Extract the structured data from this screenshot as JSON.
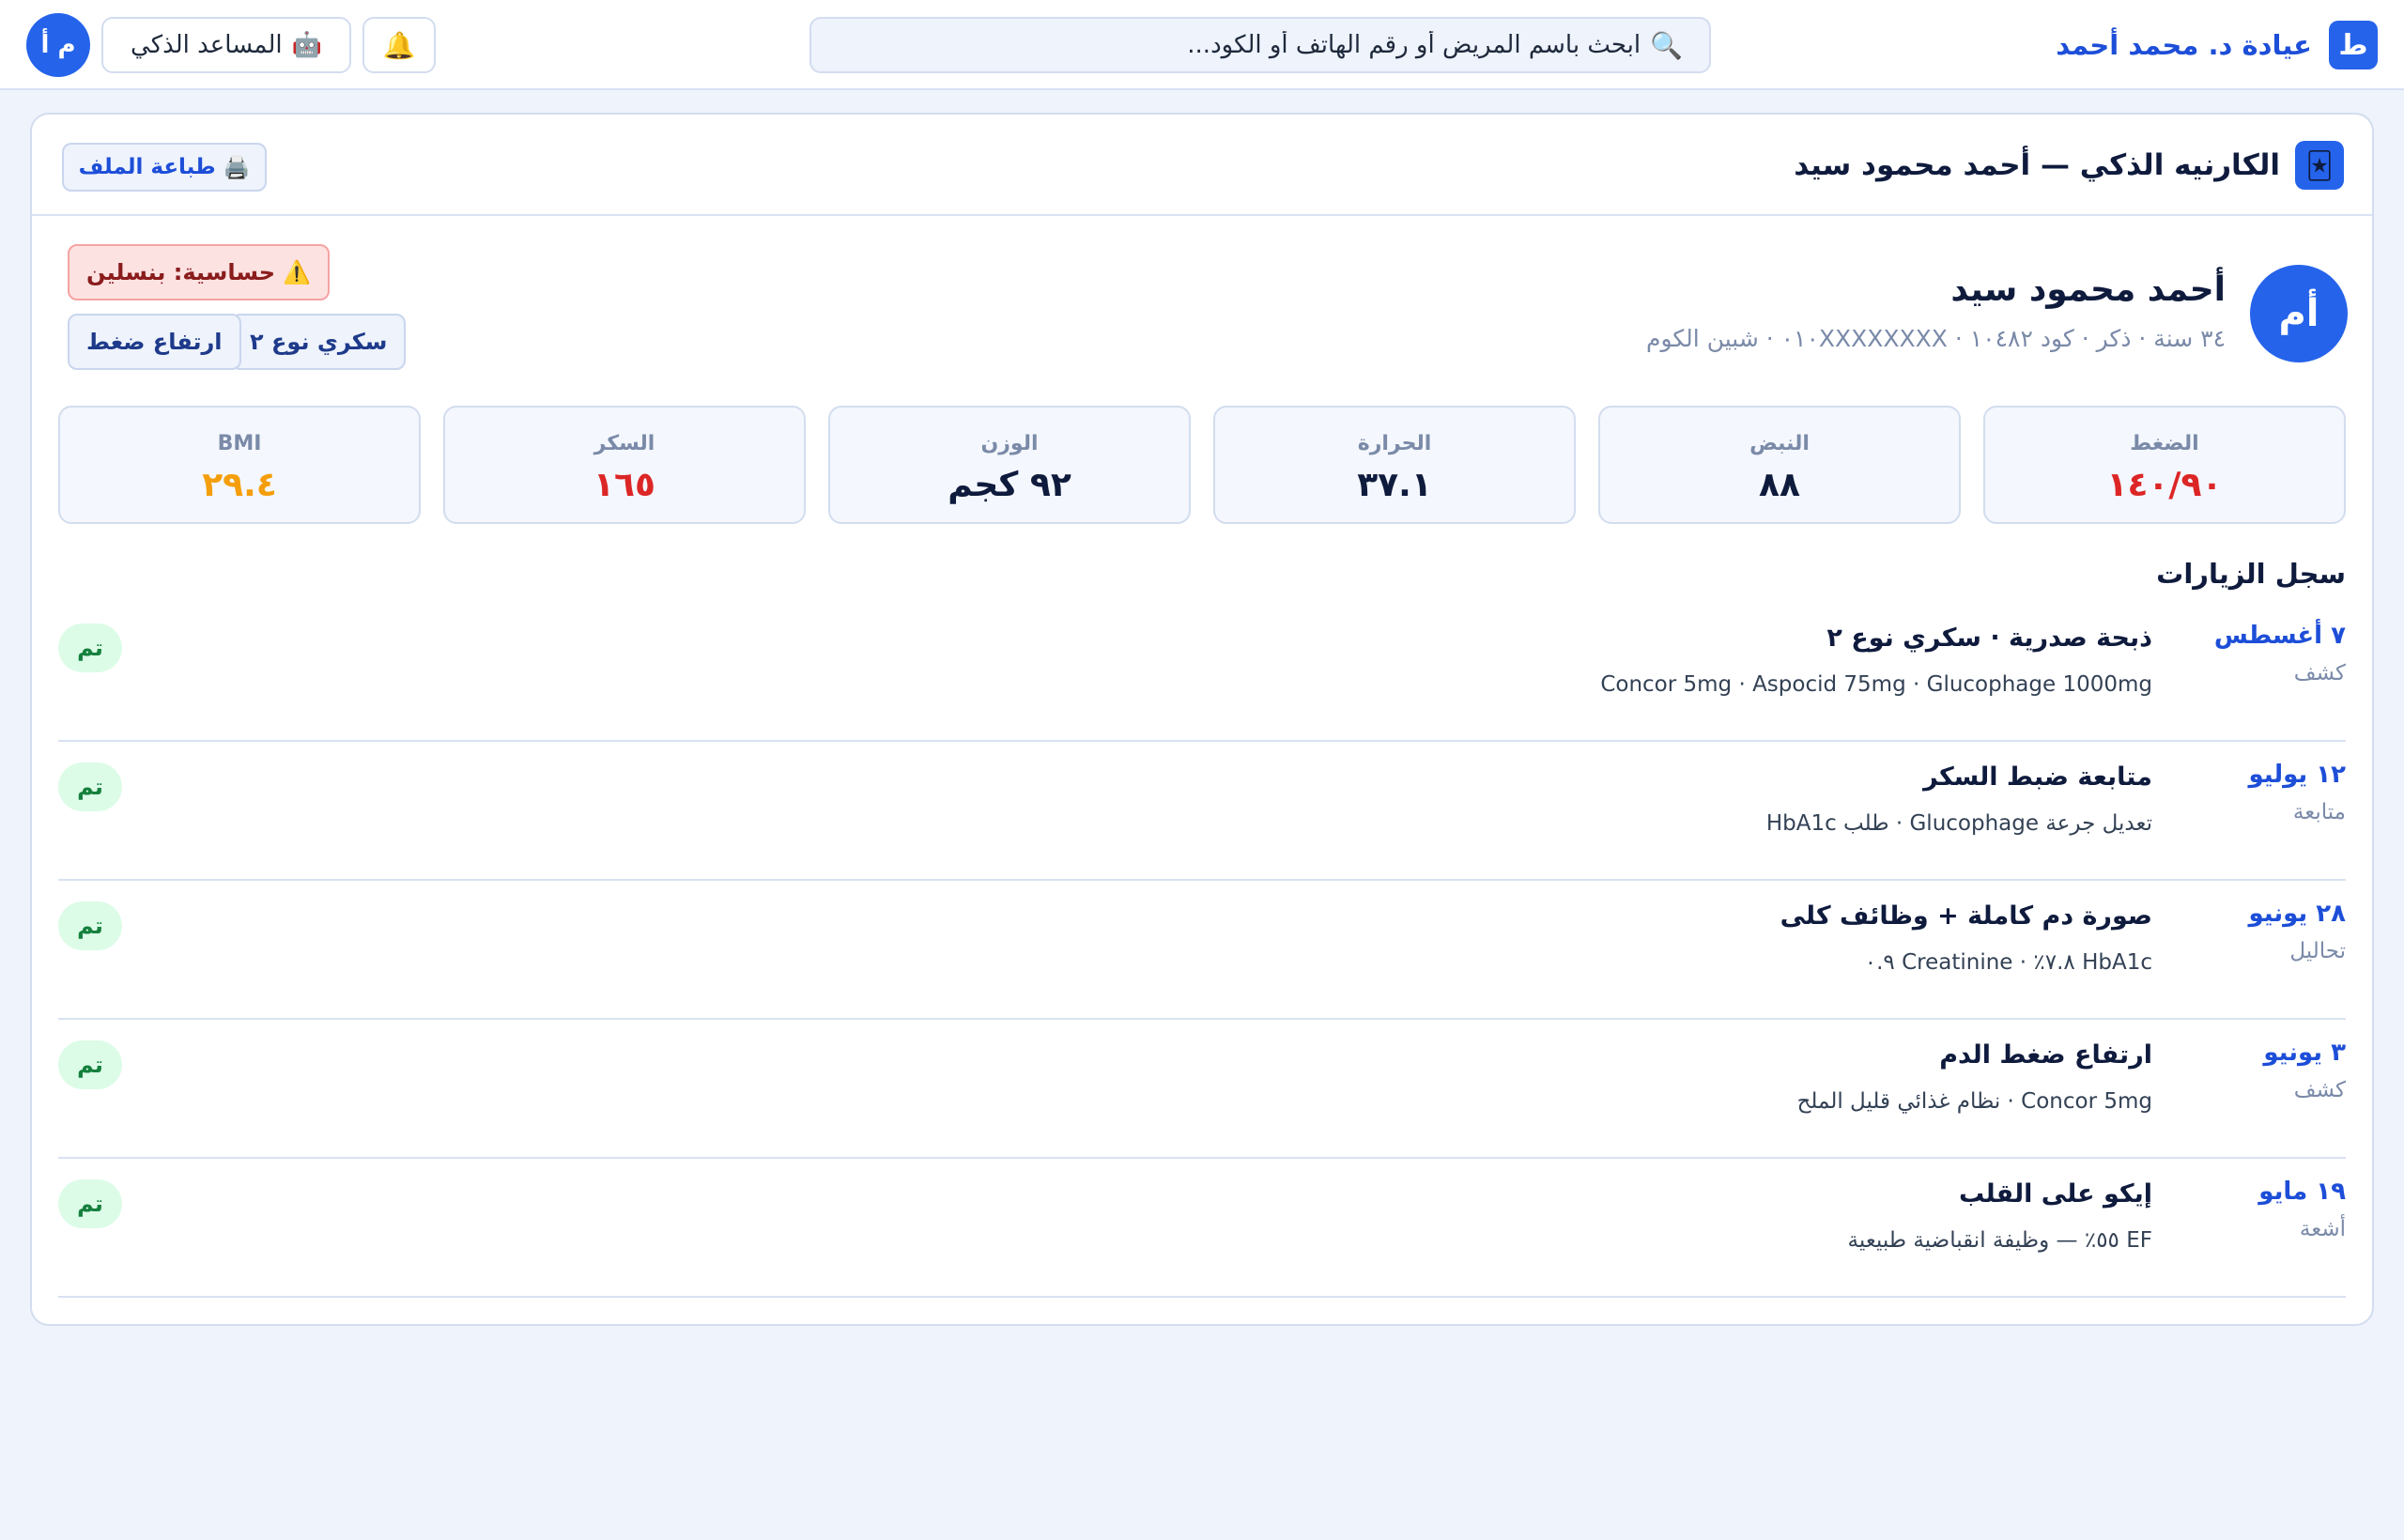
{
  "header": {
    "brand_initial": "ط",
    "brand_name": "عيادة د. محمد أحمد",
    "search_placeholder": "ابحث باسم المريض أو رقم الهاتف أو الكود...",
    "assistant_label": "المساعد الذكي",
    "user_initials": "م أ",
    "icons": {
      "search": "magnifier-icon",
      "bell": "bell-icon",
      "assistant": "robot-icon"
    }
  },
  "card": {
    "title": "الكارنيه الذكي — أحمد محمود سيد",
    "print_label": "طباعة الملف",
    "icons": {
      "card": "card-icon",
      "print": "printer-icon"
    }
  },
  "patient": {
    "initials": "أم",
    "name": "أحمد محمود سيد",
    "meta": "٣٤ سنة · ذكر · كود ١٠٤٨٢ · ٠١٠XXXXXXXX · شبين الكوم",
    "allergy": "حساسية: بنسلين",
    "tags": [
      "سكري نوع ٢",
      "ارتفاع ضغط"
    ]
  },
  "vitals": [
    {
      "label": "الضغط",
      "value": "١٤٠/٩٠",
      "color": "#dc2626"
    },
    {
      "label": "النبض",
      "value": "٨٨",
      "color": "#0f1b3d"
    },
    {
      "label": "الحرارة",
      "value": "٣٧.١",
      "color": "#0f1b3d"
    },
    {
      "label": "الوزن",
      "value": "٩٢ كجم",
      "color": "#0f1b3d"
    },
    {
      "label": "السكر",
      "value": "١٦٥",
      "color": "#dc2626"
    },
    {
      "label": "BMI",
      "value": "٢٩.٤",
      "color": "#f59e0b"
    }
  ],
  "history": {
    "title": "سجل الزيارات",
    "visits": [
      {
        "date": "٧ أغسطس",
        "type": "كشف",
        "title": "ذبحة صدرية · سكري نوع ٢",
        "details": "Concor 5mg · Aspocid 75mg · Glucophage 1000mg",
        "status": "تم"
      },
      {
        "date": "١٢ يوليو",
        "type": "متابعة",
        "title": "متابعة ضبط السكر",
        "details": "تعديل جرعة Glucophage · طلب HbA1c",
        "status": "تم"
      },
      {
        "date": "٢٨ يونيو",
        "type": "تحاليل",
        "title": "صورة دم كاملة + وظائف كلى",
        "details": "HbA1c ٧.٨٪ · Creatinine ٠.٩",
        "status": "تم"
      },
      {
        "date": "٣ يونيو",
        "type": "كشف",
        "title": "ارتفاع ضغط الدم",
        "details": "Concor 5mg · نظام غذائي قليل الملح",
        "status": "تم"
      },
      {
        "date": "١٩ مايو",
        "type": "أشعة",
        "title": "إيكو على القلب",
        "details": "EF ٥٥٪ — وظيفة انقباضية طبيعية",
        "status": "تم"
      }
    ]
  },
  "colors": {
    "accent": "#2563eb",
    "danger": "#dc2626",
    "warning": "#f59e0b",
    "success": "#15803d"
  }
}
